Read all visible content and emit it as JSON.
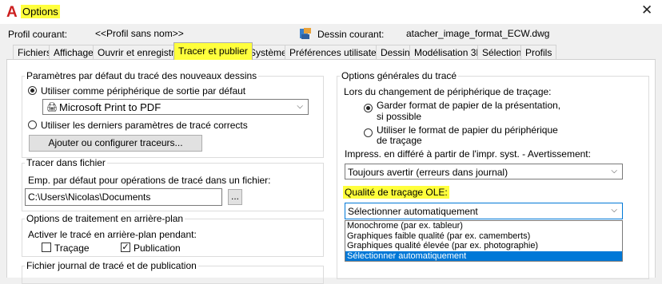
{
  "window": {
    "title": "Options",
    "close_glyph": "✕"
  },
  "header": {
    "profile_label": "Profil courant:",
    "profile_value": "<<Profil sans nom>>",
    "drawing_label": "Dessin courant:",
    "drawing_value": "atacher_image_format_ECW.dwg"
  },
  "tabs": [
    {
      "label": "Fichiers"
    },
    {
      "label": "Affichage"
    },
    {
      "label": "Ouvrir et enregistrer"
    },
    {
      "label": "Tracer et publier",
      "active": true
    },
    {
      "label": "Système"
    },
    {
      "label": "Préférences utilisateur"
    },
    {
      "label": "Dessin"
    },
    {
      "label": "Modélisation 3D"
    },
    {
      "label": "Sélection"
    },
    {
      "label": "Profils"
    }
  ],
  "defaults_group": {
    "title": "Paramètres par défaut du tracé des nouveaux dessins",
    "radio_use_device": "Utiliser comme périphérique de sortie par défaut",
    "device_value": "Microsoft Print to PDF",
    "radio_last_settings": "Utiliser les derniers paramètres de tracé corrects",
    "add_plotters_button": "Ajouter ou configurer traceurs..."
  },
  "plot_to_file": {
    "title": "Tracer dans fichier",
    "label": "Emp. par défaut pour opérations de tracé dans un fichier:",
    "path_value": "C:\\Users\\Nicolas\\Documents",
    "browse_button": "..."
  },
  "background": {
    "title": "Options de traitement en arrière-plan",
    "label": "Activer le tracé en arrière-plan pendant:",
    "plot_checkbox": "Traçage",
    "publish_checkbox": "Publication"
  },
  "log_group": {
    "title": "Fichier journal de tracé et de publication"
  },
  "general": {
    "title": "Options générales du tracé",
    "device_change_label": "Lors du changement de périphérique de traçage:",
    "radio_keep_line1": "Garder format de papier de la présentation,",
    "radio_keep_line2": "si possible",
    "radio_use_line1": "Utiliser le format de papier du périphérique",
    "radio_use_line2": "de traçage",
    "spool_label": "Impress. en différé à partir de l'impr. syst. - Avertissement:",
    "spool_value": "Toujours avertir (erreurs dans journal)",
    "ole_label": "Qualité de traçage OLE:",
    "ole_value": "Sélectionner automatiquement",
    "ole_options": [
      "Monochrome (par ex. tableur)",
      "Graphiques faible qualité (par ex. camemberts)",
      "Graphiques qualité élevée (par ex. photographie)",
      "Sélectionner automatiquement"
    ]
  },
  "colors": {
    "highlight": "#ffff3c",
    "selection": "#0078d7",
    "logo": "#cc1f1f"
  }
}
